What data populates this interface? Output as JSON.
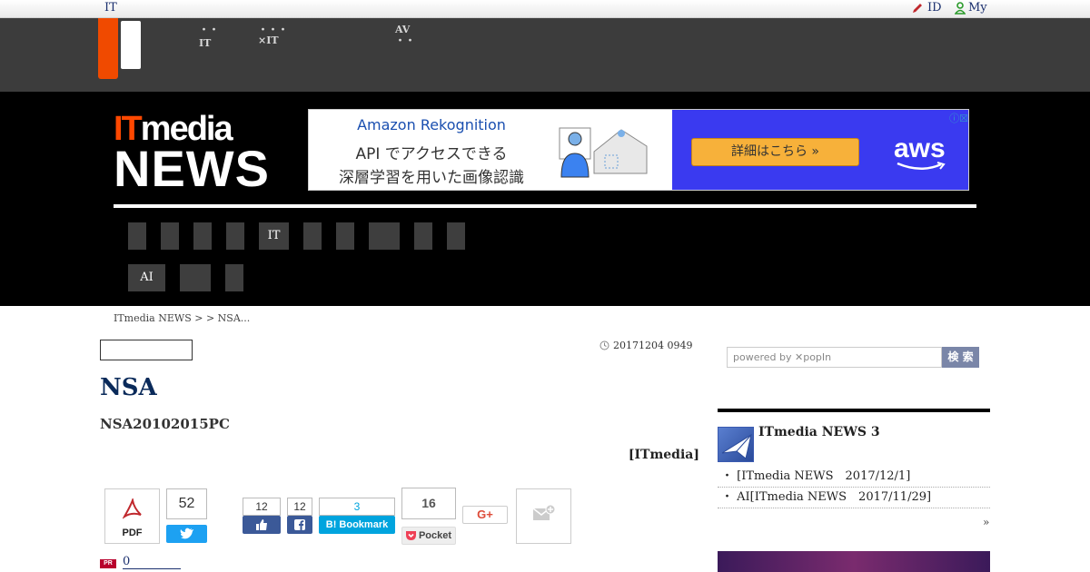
{
  "topbar": {
    "site_label": "IT",
    "id_label": "ID",
    "my_label": "My"
  },
  "site_nav": [
    {
      "line1": "・・",
      "line2": "IT"
    },
    {
      "line1": "・・・",
      "line2": "×IT"
    },
    {
      "line1": "AV",
      "line2": "・・"
    }
  ],
  "brand": {
    "it": "IT",
    "media": "media",
    "news": "NEWS"
  },
  "ad": {
    "line1": "Amazon Rekognition",
    "line2": "API でアクセスできる",
    "line3": "深層学習を用いた画像認識",
    "cta": "詳細はこちら »",
    "logo": "aws"
  },
  "tabs_row1": [
    "",
    "",
    "",
    "",
    "IT",
    "",
    "",
    "",
    "",
    ""
  ],
  "tabs_row2": [
    "AI",
    "",
    ""
  ],
  "breadcrumb": "ITmedia NEWS >  > NSA...",
  "article": {
    "date": "20171204 0949",
    "title": "NSA",
    "subtitle": "NSA20102015PC",
    "byline": "[ITmedia]"
  },
  "social": {
    "pdf_label": "PDF",
    "tweet_count": "52",
    "like_count": "12",
    "share_count": "12",
    "hatena_count": "3",
    "hatena_label": "B! Bookmark",
    "pocket_count": "16",
    "pocket_label": "Pocket",
    "gplus_label": "G+"
  },
  "pr": {
    "badge": "PR",
    "link": "0"
  },
  "sidebar": {
    "search_placeholder": "powered by ✕popIn",
    "search_button": "検 索",
    "section_title": "ITmedia NEWS 3",
    "items": [
      "[ITmedia NEWS　2017/12/1]",
      "AI[ITmedia NEWS　2017/11/29]"
    ],
    "more": "»"
  }
}
